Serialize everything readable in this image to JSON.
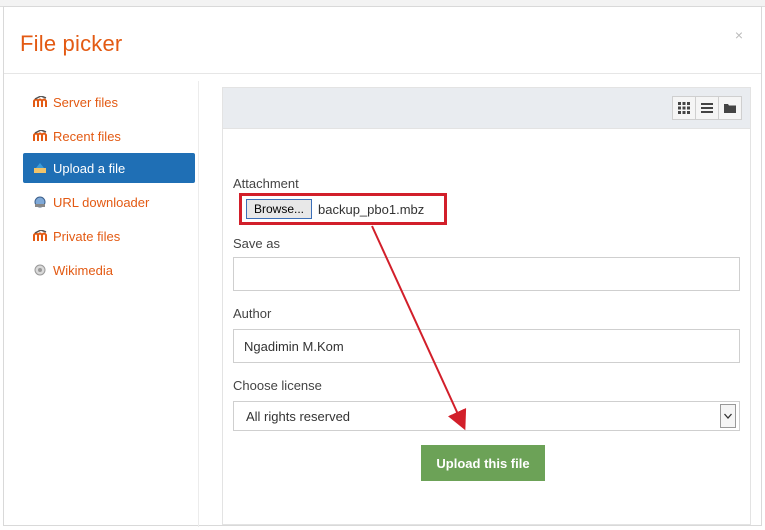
{
  "dialog": {
    "title": "File picker",
    "close": "×"
  },
  "sidebar": {
    "items": [
      {
        "label": "Server files",
        "icon": "moodle-icon",
        "active": false
      },
      {
        "label": "Recent files",
        "icon": "moodle-icon",
        "active": false
      },
      {
        "label": "Upload a file",
        "icon": "upload-icon",
        "active": true
      },
      {
        "label": "URL downloader",
        "icon": "globe-icon",
        "active": false
      },
      {
        "label": "Private files",
        "icon": "moodle-icon",
        "active": false
      },
      {
        "label": "Wikimedia",
        "icon": "wikimedia-icon",
        "active": false
      }
    ]
  },
  "toolbar": {
    "views": [
      "icons-view",
      "list-view",
      "folder-view"
    ]
  },
  "form": {
    "attachment_label": "Attachment",
    "browse_label": "Browse...",
    "filename": "backup_pbo1.mbz",
    "save_as_label": "Save as",
    "save_as_value": "",
    "author_label": "Author",
    "author_value": "Ngadimin M.Kom",
    "license_label": "Choose license",
    "license_value": "All rights reserved",
    "upload_label": "Upload this file"
  },
  "colors": {
    "accent": "#e35a13",
    "active_bg": "#1f6fb5",
    "upload_bg": "#6ca257",
    "annotation": "#d21f2a"
  }
}
